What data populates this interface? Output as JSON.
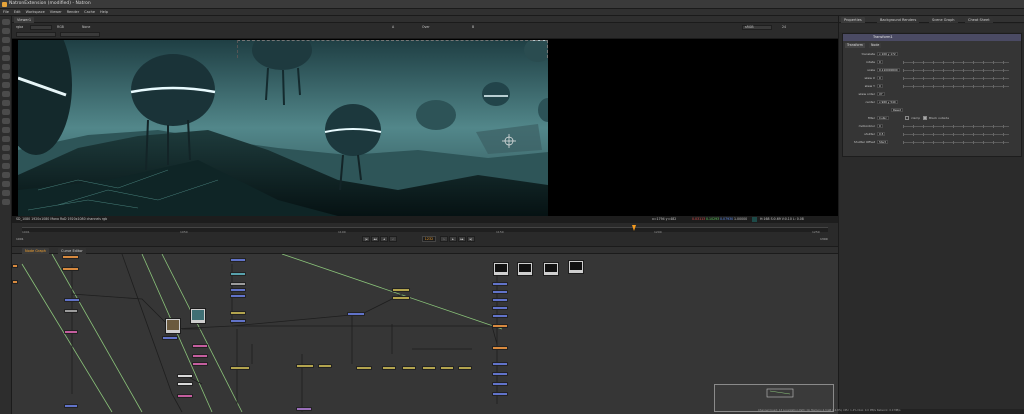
{
  "window": {
    "title": "NatronExtension (modified) - Natron"
  },
  "menubar": [
    "File",
    "Edit",
    "Workspace",
    "Viewer",
    "Render",
    "Cache",
    "Help"
  ],
  "viewer": {
    "tab": "Viewer1",
    "controls": {
      "layer": "rgba",
      "channels": "RGB",
      "alpha": "None",
      "display": "sRGB",
      "a_input": "A",
      "b_input": "B",
      "ops": "Over",
      "fps": "24"
    },
    "info_left": "SD_1080  1920x1080   Mono  RoD 1920x1080 channels rgb",
    "info_right": "x=1794 y=482",
    "color_r": "0.03113",
    "color_g": "0.10293",
    "color_b": "0.07930",
    "color_a": "1.00000",
    "hsv": "H:168 S:0.69 V:0.10  L: 0.08"
  },
  "timeline": {
    "labels": [
      "1001",
      "1050",
      "1100",
      "1150",
      "1200",
      "1250",
      "1300"
    ],
    "frame": "1232",
    "start": "1001",
    "end": "1300"
  },
  "nodegraph": {
    "tabs": [
      "Node Graph",
      "Curve Editor"
    ]
  },
  "properties": {
    "tabs": [
      "Properties",
      "Background Renders",
      "Scene Graph",
      "Cheat Sheet"
    ],
    "node_name": "Transform1",
    "section_tab": "Transform",
    "section_tab2": "Node",
    "rows": [
      {
        "label": "translate",
        "value": "x  100      y  172"
      },
      {
        "label": "rotate",
        "value": "0"
      },
      {
        "label": "scale",
        "value": "0.110000000"
      },
      {
        "label": "skew X",
        "value": "0"
      },
      {
        "label": "skew Y",
        "value": "0"
      },
      {
        "label": "skew order",
        "value": "XY"
      },
      {
        "label": "center",
        "value": "x  960      y  540"
      },
      {
        "label": "",
        "value": "Reset"
      },
      {
        "label": "filter",
        "value": "Cubic"
      },
      {
        "label": "motionblur",
        "value": "0"
      },
      {
        "label": "shutter",
        "value": "0.5"
      },
      {
        "label": "Shutter Offset",
        "value": "Start"
      }
    ],
    "clamp_label": "clamp",
    "black_outside_label": "Black outside"
  },
  "status": "Channel Count: 13   Localization Path: On   Memory 4.3 GB (14.8%)  CPU: 1.4%  Disk: 0.0 MB/s  Network: 0.0 MB/s"
}
